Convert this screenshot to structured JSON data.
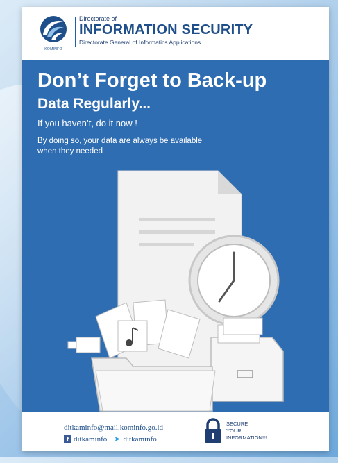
{
  "header": {
    "logo_text": "KOMINFO",
    "directorate_of": "Directorate of",
    "title": "INFORMATION SECURITY",
    "subtitle": "Directorate General of Informatics Applications"
  },
  "main": {
    "headline_1": "Don’t Forget to Back-up",
    "headline_2": "Data Regularly...",
    "headline_3": "If you haven’t, do it now !",
    "body": "By doing so, your data are always be available when they needed"
  },
  "footer": {
    "email": "ditkaminfo@mail.kominfo.go.id",
    "facebook": "ditkaminfo",
    "twitter": "ditkaminfo",
    "secure_line1": "SECURE",
    "secure_line2": "YOUR",
    "secure_line3": "INFORMATION!!!"
  },
  "colors": {
    "poster_blue": "#2f6db2",
    "brand_navy": "#1f4f8a",
    "background": "#b9d5ee"
  },
  "icons": [
    "kominfo-logo",
    "document-icon",
    "clock-icon",
    "folder-icon",
    "music-note-icon",
    "camera-icon",
    "filing-cabinet-icon",
    "facebook-icon",
    "twitter-icon",
    "padlock-icon"
  ]
}
